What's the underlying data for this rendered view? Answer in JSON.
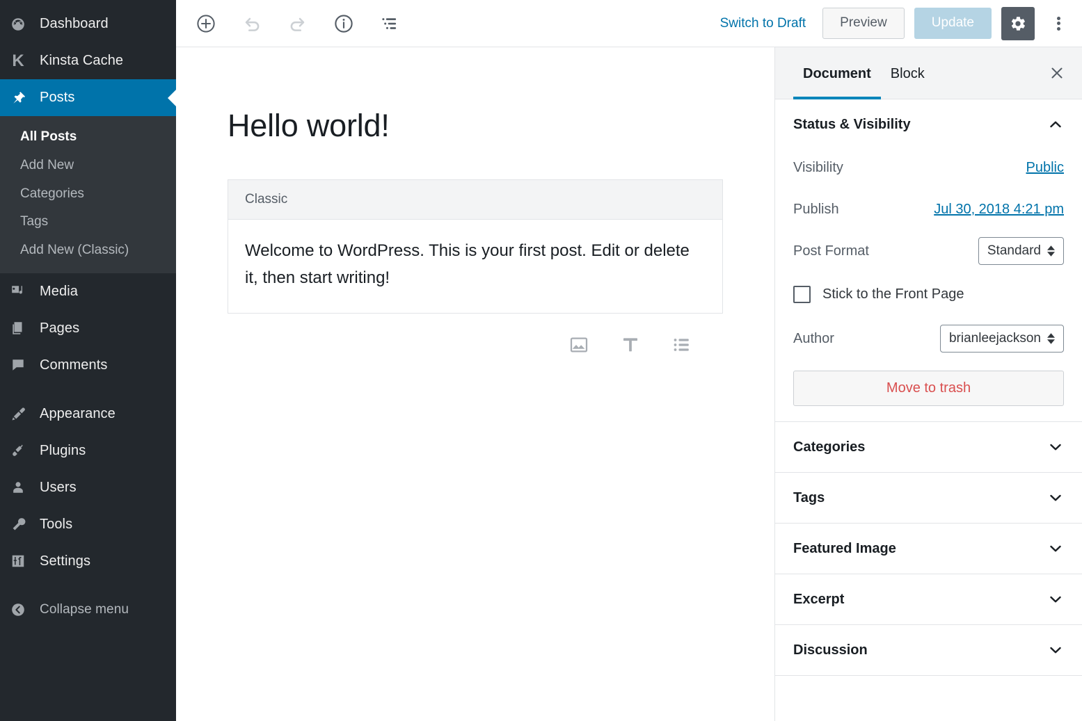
{
  "sidebar": {
    "items": [
      {
        "label": "Dashboard",
        "icon": "dashboard-icon",
        "active": false
      },
      {
        "label": "Kinsta Cache",
        "icon": "kinsta-k-icon",
        "active": false
      },
      {
        "label": "Posts",
        "icon": "pin-icon",
        "active": true
      },
      {
        "label": "Media",
        "icon": "media-icon",
        "active": false
      },
      {
        "label": "Pages",
        "icon": "pages-icon",
        "active": false
      },
      {
        "label": "Comments",
        "icon": "comments-icon",
        "active": false
      },
      {
        "label": "Appearance",
        "icon": "appearance-brush-icon",
        "active": false
      },
      {
        "label": "Plugins",
        "icon": "plugins-plug-icon",
        "active": false
      },
      {
        "label": "Users",
        "icon": "users-icon",
        "active": false
      },
      {
        "label": "Tools",
        "icon": "tools-wrench-icon",
        "active": false
      },
      {
        "label": "Settings",
        "icon": "settings-sliders-icon",
        "active": false
      }
    ],
    "submenu": [
      {
        "label": "All Posts",
        "current": true
      },
      {
        "label": "Add New",
        "current": false
      },
      {
        "label": "Categories",
        "current": false
      },
      {
        "label": "Tags",
        "current": false
      },
      {
        "label": "Add New (Classic)",
        "current": false
      }
    ],
    "collapse": {
      "label": "Collapse menu",
      "icon": "collapse-arrow-icon"
    },
    "colors": {
      "background": "#23282d",
      "submenu_background": "#32373c",
      "active": "#0073aa"
    }
  },
  "toolbar": {
    "add_block_title": "Add block",
    "undo_title": "Undo",
    "redo_title": "Redo",
    "info_title": "Content structure",
    "block_nav_title": "Block navigation",
    "switch_to_draft": "Switch to Draft",
    "preview": "Preview",
    "update": "Update",
    "update_disabled": true,
    "settings_gear_title": "Settings",
    "more_title": "More tools & options"
  },
  "editor": {
    "post_title": "Hello world!",
    "block": {
      "name": "Classic",
      "content": "Welcome to WordPress. This is your first post. Edit or delete it, then start writing!"
    },
    "quick_inserts": [
      {
        "icon": "image-icon",
        "title": "Image"
      },
      {
        "icon": "paragraph-icon",
        "title": "Paragraph"
      },
      {
        "icon": "list-icon",
        "title": "List"
      }
    ]
  },
  "settings": {
    "tabs": [
      {
        "label": "Document",
        "active": true
      },
      {
        "label": "Block",
        "active": false
      }
    ],
    "close_title": "Close settings",
    "status_panel": {
      "title": "Status & Visibility",
      "expanded": true,
      "visibility_label": "Visibility",
      "visibility_value": "Public",
      "publish_label": "Publish",
      "publish_value": "Jul 30, 2018 4:21 pm",
      "post_format_label": "Post Format",
      "post_format_value": "Standard",
      "sticky_label": "Stick to the Front Page",
      "sticky_checked": false,
      "author_label": "Author",
      "author_value": "brianleejackson",
      "trash_label": "Move to trash"
    },
    "panels": [
      {
        "title": "Categories",
        "expanded": false
      },
      {
        "title": "Tags",
        "expanded": false
      },
      {
        "title": "Featured Image",
        "expanded": false
      },
      {
        "title": "Excerpt",
        "expanded": false
      },
      {
        "title": "Discussion",
        "expanded": false
      }
    ],
    "colors": {
      "accent": "#0085ba",
      "link": "#0073aa",
      "danger": "#d94f4f"
    }
  }
}
